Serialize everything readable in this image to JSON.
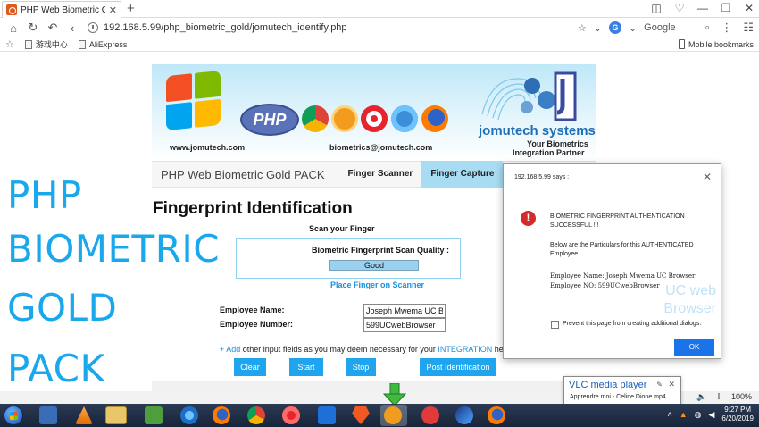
{
  "browser": {
    "tab_title": "PHP Web Biometric Gold Auth",
    "url": "192.168.5.99/php_biometric_gold/jomutech_identify.php",
    "search_engine": "Google",
    "bookmarks": [
      "游戏中心",
      "AliExpress"
    ],
    "mobile_bookmarks": "Mobile bookmarks",
    "zoom": "100%"
  },
  "side_title": [
    "PHP",
    "BIOMETRIC",
    "GOLD",
    "PACK"
  ],
  "banner": {
    "php_logo": "PHP",
    "website": "www.jomutech.com",
    "email": "biometrics@jomutech.com",
    "brand": "jomutech systems",
    "tagline_1": "Your Biometrics",
    "tagline_2": "Integration Partner"
  },
  "nav": {
    "brand": "PHP Web Biometric Gold PACK",
    "links": [
      "Finger Scanner",
      "Finger Capture"
    ],
    "active_index": 1
  },
  "page": {
    "title": "Fingerprint Identification",
    "scan_title": "Scan your Finger",
    "quality_label": "Biometric Fingerprint Scan Quality :",
    "quality_value": "Good",
    "place_finger": "Place Finger on Scanner",
    "employee_name_label": "Employee Name:",
    "employee_name_value": "Joseph Mwema UC Bro",
    "employee_number_label": "Employee Number:",
    "employee_number_value": "599UCwebBrowser",
    "note_plus": "+ Add",
    "note_middle": " other input fields as you may deem necessary for your ",
    "note_integration": "INTEGRATION",
    "note_end": " here:",
    "buttons": [
      "Clear",
      "Start",
      "Stop",
      "Post Identification"
    ]
  },
  "dialog": {
    "origin": "192.168.5.99 says :",
    "line_1": "BIOMETRIC FINGERPRINT AUTHENTICATION",
    "line_2": "SUCCESSFUL !!!",
    "line_3": "Below are the Particulars for this AUTHENTICATED",
    "line_4": "Employee",
    "line_5": "Employee Name: Joseph Mwema UC Browser",
    "line_6": "Employee NO: 599UCwebBrowser",
    "ghost_1": "UC web",
    "ghost_2": "Browser",
    "checkbox_label": "Prevent this page from creating additional dialogs.",
    "ok_label": "OK"
  },
  "vlc": {
    "title": "VLC media player",
    "subtitle": "Apprendre moi - Celine Dione.mp4"
  },
  "taskbar": {
    "time": "9:27 PM",
    "date": "6/20/2019"
  },
  "colors": {
    "accent_blue": "#1ea5ee",
    "side_title": "#19a8ec",
    "nav_active": "#a8dcf3",
    "alert_red": "#d42b2b",
    "dialog_ok": "#1a73e8"
  }
}
